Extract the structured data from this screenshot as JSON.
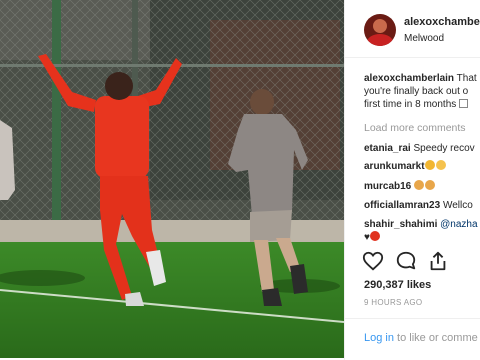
{
  "post": {
    "username": "alexoxchamberlain",
    "location": "Melwood",
    "caption_lines": [
      "That",
      "you're finally back out o",
      "first time in 8 months"
    ],
    "load_more": "Load more comments"
  },
  "comments": [
    {
      "user": "etania_rai",
      "text": "Speedy recov"
    },
    {
      "user": "arunkumarkt",
      "text": "",
      "emojis": [
        "clap",
        "thumb"
      ]
    },
    {
      "user": "murcab16",
      "text": "",
      "emojis": [
        "hand",
        "hand"
      ]
    },
    {
      "user": "officiallamran23",
      "text": "Wellco"
    },
    {
      "user": "shahir_shahimi",
      "text": "@nazha",
      "second_line_emojis": [
        "heart",
        "red"
      ]
    }
  ],
  "actions": {
    "like_icon": "heart-outline-icon",
    "comment_icon": "comment-bubble-icon",
    "share_icon": "share-upload-icon"
  },
  "likes": "290,387 likes",
  "time": "9 HOURS AGO",
  "login": {
    "link": "Log in",
    "rest": "to like or comme"
  },
  "colors": {
    "link": "#3897f0",
    "muted": "#999999",
    "text": "#262626",
    "kit_red": "#e6321c",
    "kit_grey": "#8d8784",
    "grass": "#2e7d1f"
  }
}
